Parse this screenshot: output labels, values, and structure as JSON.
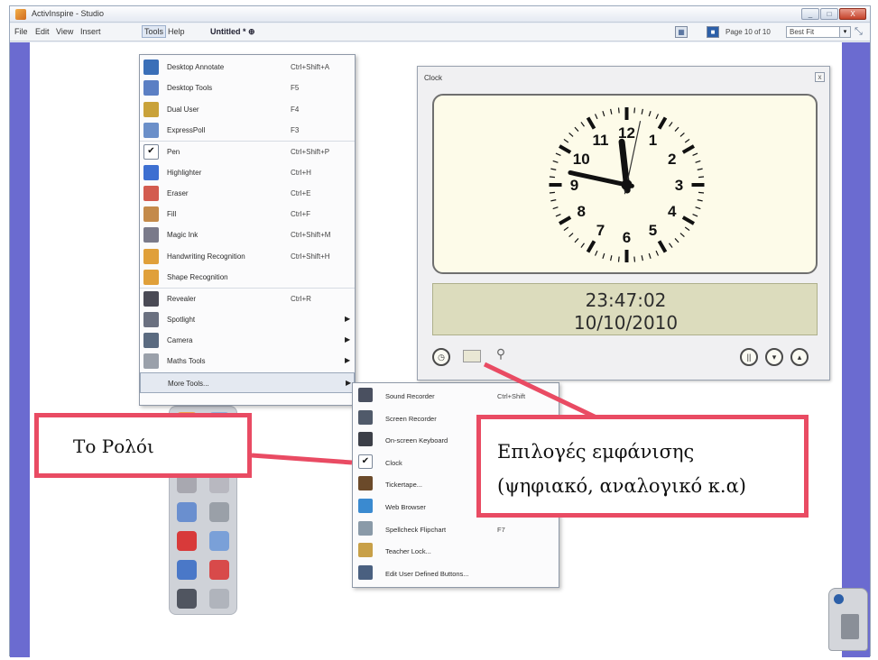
{
  "app": {
    "window_title": "ActivInspire - Studio",
    "win_buttons": [
      "_",
      "□",
      "X"
    ]
  },
  "menubar": {
    "items": [
      "File",
      "Edit",
      "View",
      "Insert",
      "Tools",
      "Help"
    ],
    "document_tab": "Untitled * ⊕",
    "page_indicator": "Page 10 of 10",
    "fit_option": "Best Fit"
  },
  "tools_menu": {
    "items": [
      {
        "label": "Desktop Annotate",
        "shortcut": "Ctrl+Shift+A",
        "icon": "desktop-annotate-icon",
        "color": "#3a6fb8"
      },
      {
        "label": "Desktop Tools",
        "shortcut": "F5",
        "icon": "desktop-tools-icon",
        "color": "#5b7fc4"
      },
      {
        "label": "Dual User",
        "shortcut": "F4",
        "icon": "dual-user-icon",
        "color": "#c9a23a"
      },
      {
        "label": "ExpressPoll",
        "shortcut": "F3",
        "icon": "expresspoll-icon",
        "color": "#6b8fc9"
      },
      {
        "label": "Pen",
        "shortcut": "Ctrl+Shift+P",
        "icon": "check-icon",
        "color": "#ffffff"
      },
      {
        "label": "Highlighter",
        "shortcut": "Ctrl+H",
        "icon": "highlighter-icon",
        "color": "#3d6fd1"
      },
      {
        "label": "Eraser",
        "shortcut": "Ctrl+E",
        "icon": "eraser-icon",
        "color": "#d35b4f"
      },
      {
        "label": "Fill",
        "shortcut": "Ctrl+F",
        "icon": "fill-icon",
        "color": "#c48a4a"
      },
      {
        "label": "Magic Ink",
        "shortcut": "Ctrl+Shift+M",
        "icon": "magic-ink-icon",
        "color": "#7a7a8a"
      },
      {
        "label": "Handwriting Recognition",
        "shortcut": "Ctrl+Shift+H",
        "icon": "handwriting-recognition-icon",
        "color": "#e0a03a"
      },
      {
        "label": "Shape Recognition",
        "shortcut": "",
        "icon": "shape-recognition-icon",
        "color": "#e0a03a"
      },
      {
        "label": "Revealer",
        "shortcut": "Ctrl+R",
        "icon": "revealer-icon",
        "color": "#4a4a55"
      },
      {
        "label": "Spotlight",
        "shortcut": "",
        "icon": "spotlight-icon",
        "color": "#6a7080",
        "submenu": true
      },
      {
        "label": "Camera",
        "shortcut": "",
        "icon": "camera-icon",
        "color": "#5a6a80",
        "submenu": true
      },
      {
        "label": "Maths Tools",
        "shortcut": "",
        "icon": "maths-tools-icon",
        "color": "#9aa0aa",
        "submenu": true
      },
      {
        "label": "More Tools...",
        "shortcut": "",
        "icon": "",
        "color": "",
        "submenu": true
      }
    ]
  },
  "more_tools_menu": {
    "items": [
      {
        "label": "Sound Recorder",
        "shortcut": "Ctrl+Shift",
        "icon": "sound-recorder-icon",
        "color": "#4a5060"
      },
      {
        "label": "Screen Recorder",
        "shortcut": "",
        "icon": "screen-recorder-icon",
        "color": "#505a6a",
        "submenu": true
      },
      {
        "label": "On-screen Keyboard",
        "shortcut": "",
        "icon": "keyboard-icon",
        "color": "#3c3f48"
      },
      {
        "label": "Clock",
        "shortcut": "",
        "icon": "check-icon",
        "color": "#ffffff"
      },
      {
        "label": "Tickertape...",
        "shortcut": "",
        "icon": "tickertape-icon",
        "color": "#6b4a2a"
      },
      {
        "label": "Web Browser",
        "shortcut": "",
        "icon": "web-browser-icon",
        "color": "#3a8ad0"
      },
      {
        "label": "Spellcheck Flipchart",
        "shortcut": "F7",
        "icon": "spellcheck-icon",
        "color": "#8a9aa8"
      },
      {
        "label": "Teacher Lock...",
        "shortcut": "",
        "icon": "teacher-lock-icon",
        "color": "#c8a048"
      },
      {
        "label": "Edit User Defined Buttons...",
        "shortcut": "",
        "icon": "edit-buttons-icon",
        "color": "#4a6080"
      }
    ]
  },
  "clock": {
    "window_title": "Clock",
    "close_label": "x",
    "digital_time": "23:47:02",
    "digital_date": "10/10/2010",
    "analog_numbers": [
      "12",
      "1",
      "2",
      "3",
      "4",
      "5",
      "6",
      "7",
      "8",
      "9",
      "10",
      "11"
    ],
    "hour": 23,
    "minute": 47,
    "second": 2,
    "mode_buttons": [
      "analog-mode-icon",
      "digital-mode-icon",
      "timer-mode-icon"
    ],
    "control_buttons": [
      "||",
      "▾",
      "▴"
    ]
  },
  "annotations": {
    "clock_label": "Το Ρολόι",
    "options_line1": "Επιλογές εμφάνισης",
    "options_line2": "(ψηφιακό, αναλογικό κ.α)",
    "callout_color": "#e94b63"
  },
  "colors": {
    "canvas_side_bars": "#6b6bd0",
    "clock_face_bg": "#fdfbe9",
    "digital_bg": "#dcdcbd"
  }
}
